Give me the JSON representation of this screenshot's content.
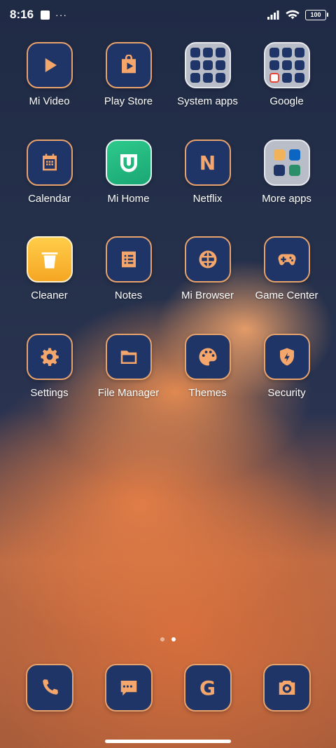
{
  "status": {
    "time": "8:16",
    "battery": "100",
    "more": "···"
  },
  "rows": [
    [
      {
        "label": "Mi Video",
        "icon": "play-icon"
      },
      {
        "label": "Play Store",
        "icon": "play-store-icon"
      },
      {
        "label": "System apps",
        "icon": "folder-icon"
      },
      {
        "label": "Google",
        "icon": "folder-icon"
      }
    ],
    [
      {
        "label": "Calendar",
        "icon": "calendar-icon"
      },
      {
        "label": "Mi Home",
        "icon": "mi-home-icon"
      },
      {
        "label": "Netflix",
        "icon": "netflix-icon",
        "glyph": "N"
      },
      {
        "label": "More apps",
        "icon": "folder-icon"
      }
    ],
    [
      {
        "label": "Cleaner",
        "icon": "trash-icon"
      },
      {
        "label": "Notes",
        "icon": "notes-icon"
      },
      {
        "label": "Mi Browser",
        "icon": "globe-icon"
      },
      {
        "label": "Game Center",
        "icon": "gamepad-icon"
      }
    ],
    [
      {
        "label": "Settings",
        "icon": "gear-icon"
      },
      {
        "label": "File Manager",
        "icon": "folder-icon"
      },
      {
        "label": "Themes",
        "icon": "palette-icon"
      },
      {
        "label": "Security",
        "icon": "shield-icon"
      }
    ]
  ],
  "dock": [
    {
      "name": "phone",
      "icon": "phone-icon"
    },
    {
      "name": "messages",
      "icon": "message-icon"
    },
    {
      "name": "google",
      "icon": "google-icon",
      "glyph": "G"
    },
    {
      "name": "camera",
      "icon": "camera-icon"
    }
  ],
  "pager": {
    "pages": 2,
    "active": 2
  },
  "colors": {
    "icon_bg": "#1f3568",
    "icon_accent": "#f4a66b",
    "icon_border": "#e8a26c"
  }
}
